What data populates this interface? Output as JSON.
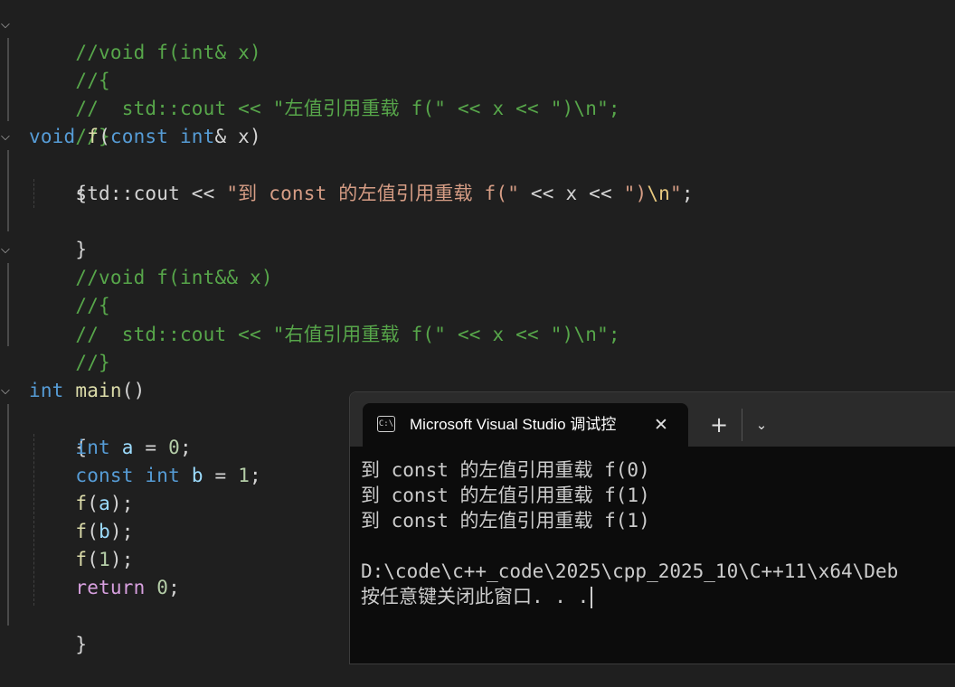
{
  "code": {
    "l1": {
      "comment": "//void f(int& x)"
    },
    "l2": {
      "comment": "//{"
    },
    "l3": {
      "comment": "//  std::cout << \"左值引用重载 f(\" << x << \")\\n\";"
    },
    "l4": {
      "comment": "//}"
    },
    "l5": {
      "kw_void": "void",
      "fn": "f",
      "open": "(",
      "kw_const": "const",
      "kw_int": "int",
      "rest": "& x)"
    },
    "l6": {
      "text": "{"
    },
    "l7": {
      "cout": "std::cout",
      "op1": " << ",
      "str": "\"到 const 的左值引用重载 f(\"",
      "op2": " << ",
      "x": "x",
      "op3": " << ",
      "str2a": "\")",
      "esc": "\\n",
      "str2b": "\"",
      "semi": ";"
    },
    "l8": {
      "text": "}"
    },
    "l9": {
      "comment": "//void f(int&& x)"
    },
    "l10": {
      "comment": "//{"
    },
    "l11": {
      "comment": "//  std::cout << \"右值引用重载 f(\" << x << \")\\n\";"
    },
    "l12": {
      "comment": "//}"
    },
    "l13": {
      "kw_int": "int",
      "fn": "main",
      "rest": "()"
    },
    "l14": {
      "text": "{"
    },
    "l15": {
      "kw_int": "int",
      "var": "a",
      "eq": " = ",
      "num": "0",
      "semi": ";"
    },
    "l16": {
      "kw_const": "const",
      "kw_int": "int",
      "var": "b",
      "eq": " = ",
      "num": "1",
      "semi": ";"
    },
    "l17": {
      "fn": "f",
      "open": "(",
      "var": "a",
      "close": ");"
    },
    "l18": {
      "fn": "f",
      "open": "(",
      "var": "b",
      "close": ");"
    },
    "l19": {
      "fn": "f",
      "open": "(",
      "num": "1",
      "close": ");"
    },
    "l20": {
      "kw_return": "return",
      "num": "0",
      "semi": ";"
    },
    "l21": {
      "text": "}"
    }
  },
  "terminal": {
    "tab_title": "Microsoft Visual Studio 调试控",
    "tab_icon": "C:\\",
    "close_glyph": "✕",
    "new_tab_glyph": "+",
    "dropdown_glyph": "⌄",
    "output": [
      "到 const 的左值引用重载 f(0)",
      "到 const 的左值引用重载 f(1)",
      "到 const 的左值引用重载 f(1)",
      "",
      "D:\\code\\c++_code\\2025\\cpp_2025_10\\C++11\\x64\\Deb",
      "按任意键关闭此窗口. . ."
    ]
  },
  "icons": {
    "fold": "chevron-down-icon"
  },
  "colors": {
    "background": "#1f1f1f",
    "comment": "#57a64a",
    "keyword": "#569cd6",
    "function": "#dcdcaa",
    "string": "#d69d85",
    "number": "#b5cea8",
    "variable": "#9cdcfe",
    "control": "#d8a0df",
    "terminal_bg": "#0c0c0c"
  }
}
